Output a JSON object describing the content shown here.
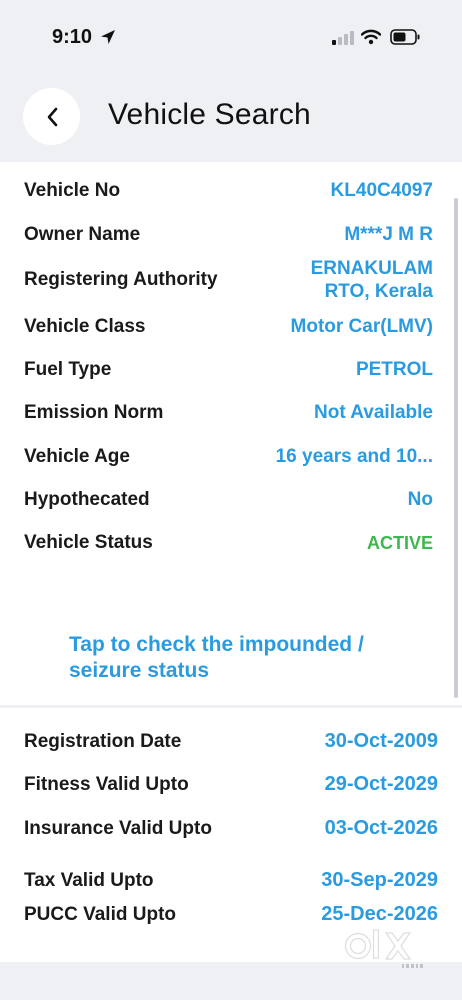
{
  "status_bar": {
    "time": "9:10",
    "icons": [
      "location-arrow-icon",
      "cellular-signal-icon",
      "wifi-icon",
      "battery-icon"
    ]
  },
  "header": {
    "back_icon": "chevron-left-icon",
    "title": "Vehicle Search"
  },
  "vehicle_details": [
    {
      "label": "Vehicle No",
      "value": "KL40C4097"
    },
    {
      "label": "Owner Name",
      "value": "M***J M R"
    },
    {
      "label": "Registering Authority",
      "value": "ERNAKULAM\nRTO, Kerala"
    },
    {
      "label": "Vehicle Class",
      "value": "Motor Car(LMV)"
    },
    {
      "label": "Fuel Type",
      "value": "PETROL"
    },
    {
      "label": "Emission Norm",
      "value": "Not Available"
    },
    {
      "label": "Vehicle Age",
      "value": "16 years and 10..."
    },
    {
      "label": "Hypothecated",
      "value": "No"
    },
    {
      "label": "Vehicle Status",
      "value": "ACTIVE"
    }
  ],
  "impound_link": "Tap to check the impounded / seizure status",
  "validity_details": [
    {
      "label": "Registration Date",
      "value": "30-Oct-2009"
    },
    {
      "label": "Fitness Valid Upto",
      "value": "29-Oct-2029"
    },
    {
      "label": "Insurance Valid Upto",
      "value": "03-Oct-2026"
    },
    {
      "label": "Tax Valid Upto",
      "value": "30-Sep-2029"
    },
    {
      "label": "PUCC Valid Upto",
      "value": "25-Dec-2026"
    }
  ],
  "watermark": {
    "text": "OLX",
    "sub": "INDIA"
  },
  "colors": {
    "accent": "#2b9be0",
    "active": "#3db84e",
    "background": "#eef0f3",
    "card": "#ffffff"
  }
}
